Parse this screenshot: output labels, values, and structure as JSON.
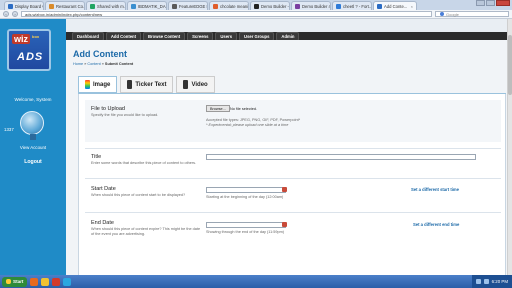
{
  "browser": {
    "tabs": [
      {
        "label": "Display Board v...",
        "color": "#2b6cc4",
        "active": false
      },
      {
        "label": "Restaurant Co...",
        "color": "#d98b2b",
        "active": false
      },
      {
        "label": "Shared with m...",
        "color": "#1fa463",
        "active": false
      },
      {
        "label": "IBDMATIK_DA...",
        "color": "#3a8fd0",
        "active": false
      },
      {
        "label": "FeatureEDGE P...",
        "color": "#5a5a5a",
        "active": false
      },
      {
        "label": "chcolate meanin...",
        "color": "#e05d2c",
        "active": false
      },
      {
        "label": "Demo Builder -",
        "color": "#222222",
        "active": false
      },
      {
        "label": "Demo Builder 4...",
        "color": "#7a3ea0",
        "active": false
      },
      {
        "label": "cheetl ? - Fort...",
        "color": "#2e7bd8",
        "active": false
      },
      {
        "label": "Add Conte...",
        "color": "#2b6cc4",
        "active": true
      }
    ],
    "url": "ads.wizbox.in/admin/index.php/content/new",
    "search_placeholder": "Google"
  },
  "sidebar": {
    "logo": {
      "top": "wiz",
      "box": "box",
      "bottom": "ADS"
    },
    "welcome": "Welcome, System",
    "count": "1337",
    "view_account": "View Account",
    "logout": "Logout"
  },
  "menu": [
    "Dashboard",
    "Add Content",
    "Browse Content",
    "Screens",
    "Users",
    "User Groups",
    "Admin"
  ],
  "content": {
    "title": "Add Content",
    "breadcrumb": {
      "home": "Home",
      "sep1": " » ",
      "content": "Content",
      "sep2": " » ",
      "current": "Submit Content"
    },
    "tabs": [
      {
        "label": "Image",
        "active": true
      },
      {
        "label": "Ticker Text",
        "active": false
      },
      {
        "label": "Video",
        "active": false
      }
    ],
    "fields": {
      "file": {
        "label": "File to Upload",
        "desc": "Specify the file you would like to upload.",
        "browse": "Browse...",
        "no_file": "No file selected.",
        "hint1": "Accepted file types: JPEG, PNG, GIF, PDF, Powerpoint*",
        "hint2": "* Experimental; please upload one slide at a time"
      },
      "title": {
        "label": "Title",
        "desc": "Enter some words that describe this piece of content to others."
      },
      "start": {
        "label": "Start Date",
        "desc": "When should this piece of content start to be displayed?",
        "hint": "Starting at the beginning of the day (12:00am)",
        "link": "Set a different start time"
      },
      "end": {
        "label": "End Date",
        "desc": "When should this piece of content expire? This might be the date of the event you are advertising.",
        "hint": "Showing through the end of the day (11:59pm)",
        "link": "Set a different end time"
      }
    }
  },
  "taskbar": {
    "start": "Start",
    "time": "6:20 PM"
  }
}
